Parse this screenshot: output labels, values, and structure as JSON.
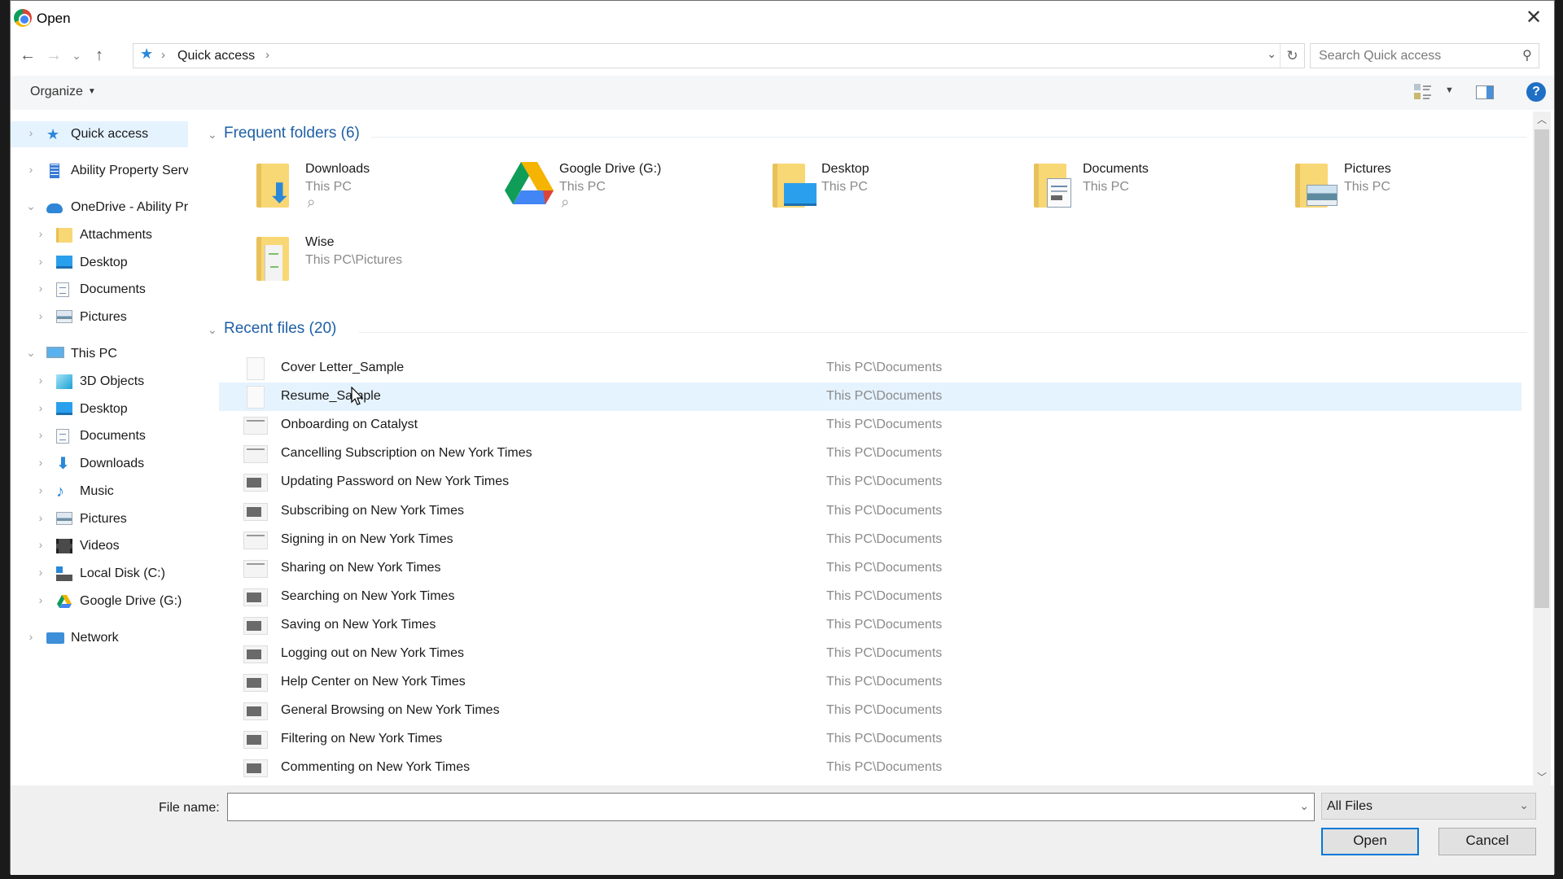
{
  "window": {
    "title": "Open",
    "close_label": "✕"
  },
  "nav": {
    "back_icon": "←",
    "forward_icon": "→",
    "recent_icon": "⌄",
    "up_icon": "↑",
    "breadcrumb": [
      "Quick access"
    ],
    "separator": "›",
    "address_dropdown_icon": "⌄",
    "refresh_icon": "↻",
    "search_placeholder": "Search Quick access",
    "search_value": "",
    "search_icon": "⚲"
  },
  "toolbar": {
    "organize_label": "Organize",
    "organize_caret": "▼",
    "view_caret": "▼",
    "help_label": "?"
  },
  "sidebar": {
    "items": [
      {
        "label": "Quick access",
        "icon": "star-icon",
        "expanded": false,
        "selected": true
      },
      {
        "label": "Ability Property Servi",
        "icon": "building-icon",
        "expanded": false
      },
      {
        "label": "OneDrive - Ability Pro",
        "icon": "cloud-icon",
        "expanded": true
      },
      {
        "label": "Attachments",
        "icon": "folder-icon",
        "expanded": false
      },
      {
        "label": "Desktop",
        "icon": "desktop-icon",
        "expanded": false
      },
      {
        "label": "Documents",
        "icon": "documents-icon",
        "expanded": false
      },
      {
        "label": "Pictures",
        "icon": "pictures-icon",
        "expanded": false
      },
      {
        "label": "This PC",
        "icon": "computer-icon",
        "expanded": true
      },
      {
        "label": "3D Objects",
        "icon": "3d-objects-icon",
        "expanded": false
      },
      {
        "label": "Desktop",
        "icon": "desktop-icon",
        "expanded": false
      },
      {
        "label": "Documents",
        "icon": "documents-icon",
        "expanded": false
      },
      {
        "label": "Downloads",
        "icon": "download-icon",
        "expanded": false
      },
      {
        "label": "Music",
        "icon": "music-icon",
        "expanded": false
      },
      {
        "label": "Pictures",
        "icon": "pictures-icon",
        "expanded": false
      },
      {
        "label": "Videos",
        "icon": "videos-icon",
        "expanded": false
      },
      {
        "label": "Local Disk (C:)",
        "icon": "disk-icon",
        "expanded": false
      },
      {
        "label": "Google Drive (G:)",
        "icon": "google-drive-icon",
        "expanded": false
      },
      {
        "label": "Network",
        "icon": "network-icon",
        "expanded": false
      }
    ],
    "chevron_collapsed": "›",
    "chevron_expanded": "⌄"
  },
  "frequent": {
    "title": "Frequent folders (6)",
    "chevron": "⌄",
    "folders": [
      {
        "name": "Downloads",
        "location": "This PC",
        "pinned": true,
        "icon": "downloads-folder-icon"
      },
      {
        "name": "Google Drive (G:)",
        "location": "This PC",
        "pinned": true,
        "icon": "google-drive-icon"
      },
      {
        "name": "Desktop",
        "location": "This PC",
        "pinned": false,
        "icon": "desktop-folder-icon"
      },
      {
        "name": "Documents",
        "location": "This PC",
        "pinned": false,
        "icon": "documents-folder-icon"
      },
      {
        "name": "Pictures",
        "location": "This PC",
        "pinned": false,
        "icon": "pictures-folder-icon"
      },
      {
        "name": "Wise",
        "location": "This PC\\Pictures",
        "pinned": false,
        "icon": "folder-icon"
      }
    ],
    "pin_icon": "📌"
  },
  "recent": {
    "title": "Recent files (20)",
    "chevron": "⌄",
    "files": [
      {
        "name": "Cover Letter_Sample",
        "location": "This PC\\Documents",
        "thumb": "doc"
      },
      {
        "name": "Resume_Sample",
        "location": "This PC\\Documents",
        "thumb": "doc",
        "hover": true
      },
      {
        "name": "Onboarding on Catalyst",
        "location": "This PC\\Documents",
        "thumb": "light"
      },
      {
        "name": "Cancelling Subscription on New York Times",
        "location": "This PC\\Documents",
        "thumb": "light"
      },
      {
        "name": "Updating Password on New York Times",
        "location": "This PC\\Documents",
        "thumb": "dark"
      },
      {
        "name": "Subscribing on New York Times",
        "location": "This PC\\Documents",
        "thumb": "dark"
      },
      {
        "name": "Signing in on New York Times",
        "location": "This PC\\Documents",
        "thumb": "light"
      },
      {
        "name": "Sharing on New York Times",
        "location": "This PC\\Documents",
        "thumb": "light"
      },
      {
        "name": "Searching on New York Times",
        "location": "This PC\\Documents",
        "thumb": "dark"
      },
      {
        "name": "Saving on New York Times",
        "location": "This PC\\Documents",
        "thumb": "dark"
      },
      {
        "name": "Logging out on New York Times",
        "location": "This PC\\Documents",
        "thumb": "dark"
      },
      {
        "name": "Help Center on New York Times",
        "location": "This PC\\Documents",
        "thumb": "dark"
      },
      {
        "name": "General Browsing on New York Times",
        "location": "This PC\\Documents",
        "thumb": "dark"
      },
      {
        "name": "Filtering on New York Times",
        "location": "This PC\\Documents",
        "thumb": "dark"
      },
      {
        "name": "Commenting on New York Times",
        "location": "This PC\\Documents",
        "thumb": "dark"
      }
    ]
  },
  "scrollbar": {
    "up_icon": "︿",
    "down_icon": "﹀",
    "visible_fraction": 0.75,
    "position": 0.0
  },
  "footer": {
    "file_name_label": "File name:",
    "file_name_value": "",
    "file_name_dropdown_icon": "⌄",
    "file_type_value": "All Files",
    "file_type_dropdown_icon": "⌄",
    "open_label": "Open",
    "cancel_label": "Cancel"
  }
}
